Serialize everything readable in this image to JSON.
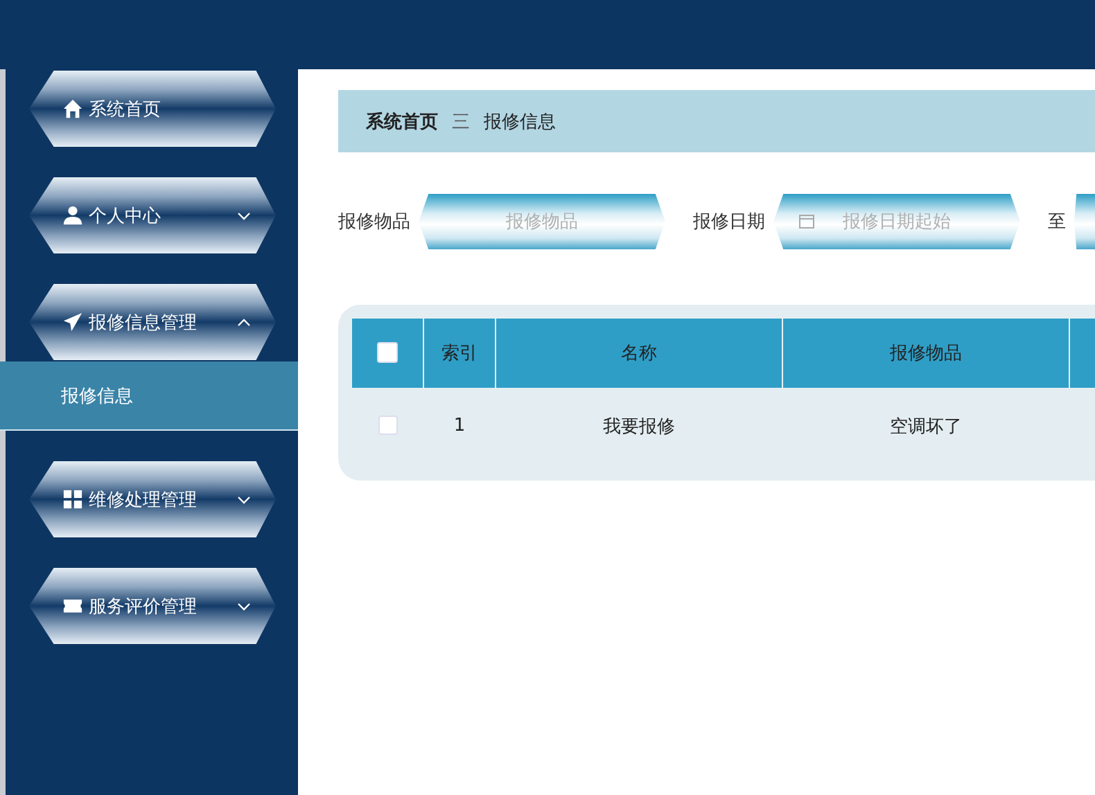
{
  "sidebar": {
    "items": [
      {
        "kind": "link",
        "label": "系统首页"
      },
      {
        "kind": "menu",
        "label": "个人中心",
        "expanded": false
      },
      {
        "kind": "menu",
        "label": "报修信息管理",
        "expanded": true,
        "children": [
          {
            "label": "报修信息",
            "selected": true
          }
        ]
      },
      {
        "kind": "menu",
        "label": "维修处理管理",
        "expanded": false
      },
      {
        "kind": "menu",
        "label": "服务评价管理",
        "expanded": false
      }
    ]
  },
  "breadcrumb": {
    "items": [
      "系统首页",
      "报修信息"
    ],
    "separator": "三"
  },
  "search": {
    "fields": [
      {
        "label": "报修物品",
        "placeholder": "报修物品",
        "kind": "text"
      },
      {
        "label": "报修日期",
        "placeholder": "报修日期起始",
        "kind": "date"
      }
    ],
    "range_separator": "至"
  },
  "table": {
    "select_all_checked": false,
    "columns": [
      "索引",
      "名称",
      "报修物品"
    ],
    "rows": [
      {
        "checked": false,
        "cells": [
          "1",
          "我要报修",
          "空调坏了"
        ]
      }
    ]
  }
}
